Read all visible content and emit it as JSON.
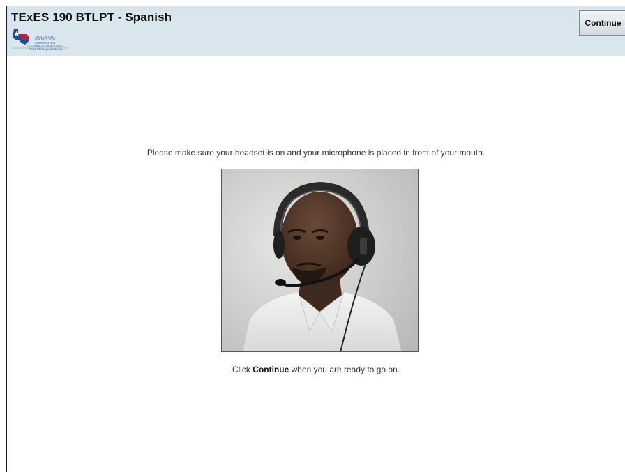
{
  "header": {
    "title": "TExES 190 BTLPT - Spanish",
    "logo_lines": [
      "STATE BOARD",
      "FOR EDUCATOR",
      "CERTIFICATION",
      "TEXAS EDUCATION AGENCY",
      "TExES 190 Proper Art Set etc"
    ],
    "continue_label": "Continue"
  },
  "main": {
    "instruction": "Please make sure your headset is on and your microphone is placed in front of your mouth.",
    "continue_prefix": "Click ",
    "continue_keyword": "Continue",
    "continue_suffix": " when you are ready to go on."
  }
}
